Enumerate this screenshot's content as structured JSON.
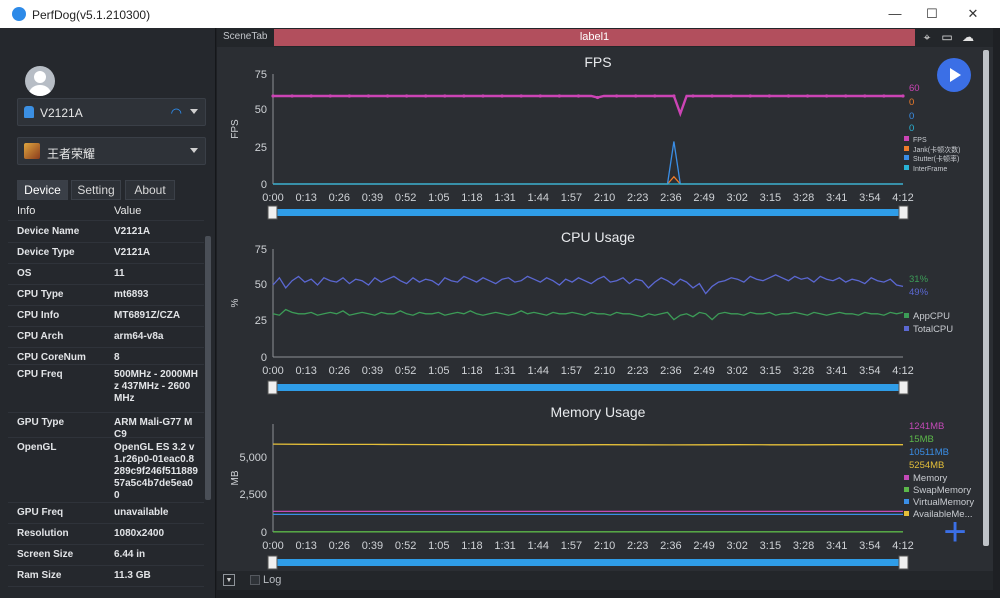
{
  "window": {
    "title": "PerfDog(v5.1.210300)"
  },
  "device": {
    "name": "V2121A"
  },
  "app": {
    "name": "王者荣耀"
  },
  "tabs": [
    "Device",
    "Setting",
    "About"
  ],
  "info": {
    "headers": [
      "Info",
      "Value"
    ],
    "rows": [
      {
        "k": "Device Name",
        "v": "V2121A"
      },
      {
        "k": "Device Type",
        "v": "V2121A"
      },
      {
        "k": "OS",
        "v": "11"
      },
      {
        "k": "CPU Type",
        "v": "mt6893"
      },
      {
        "k": "CPU Info",
        "v": "MT6891Z/CZA"
      },
      {
        "k": "CPU Arch",
        "v": "arm64-v8a"
      },
      {
        "k": "CPU CoreNum",
        "v": "8"
      },
      {
        "k": "CPU Freq",
        "v": "500MHz - 2000MHz 437MHz - 2600MHz"
      },
      {
        "k": "GPU Type",
        "v": "ARM Mali-G77 MC9"
      },
      {
        "k": "OpenGL",
        "v": "OpenGL ES 3.2 v1.r26p0-01eac0.8289c9f246f51188957a5c4b7de5ea00"
      },
      {
        "k": "GPU Freq",
        "v": "unavailable"
      },
      {
        "k": "Resolution",
        "v": "1080x2400"
      },
      {
        "k": "Screen Size",
        "v": "6.44 in"
      },
      {
        "k": "Ram Size",
        "v": "11.3 GB"
      }
    ]
  },
  "scene": {
    "tab": "SceneTab",
    "label": "label1"
  },
  "bottom": {
    "log": "Log"
  },
  "colors": {
    "fps": "#cc44b5",
    "jank": "#f07c2a",
    "stutter": "#3a8ee6",
    "interframe": "#29b3d6",
    "appcpu": "#3c9c57",
    "totalcpu": "#5b68d2",
    "memory": "#c44ab8",
    "swap": "#5cb84a",
    "virtual": "#3a8ee6",
    "available": "#e4bf39",
    "accent": "#3b6fe6"
  },
  "chart_data": [
    {
      "type": "line",
      "title": "FPS",
      "ylabel": "FPS",
      "ylim": [
        0,
        75
      ],
      "yticks": [
        "75",
        "50",
        "25",
        "0"
      ],
      "xticks": [
        "0:00",
        "0:13",
        "0:26",
        "0:39",
        "0:52",
        "1:05",
        "1:18",
        "1:31",
        "1:44",
        "1:57",
        "2:10",
        "2:23",
        "2:36",
        "2:49",
        "3:02",
        "3:15",
        "3:28",
        "3:41",
        "3:54",
        "4:12"
      ],
      "series": [
        {
          "name": "FPS",
          "current": "60",
          "values": [
            60,
            60,
            60,
            60,
            60,
            60,
            60,
            60,
            60,
            60,
            60,
            60,
            60,
            60,
            60,
            60,
            60,
            60,
            60,
            60,
            60,
            60,
            60,
            60,
            60,
            60,
            60,
            60,
            60,
            60,
            60,
            60,
            60,
            60,
            60,
            60,
            60,
            60,
            60,
            60,
            60,
            60,
            60,
            60,
            60,
            60,
            60,
            60,
            60,
            60,
            60,
            59,
            60,
            60,
            60,
            60,
            60,
            60,
            60,
            60,
            60,
            60,
            60,
            60,
            48,
            60,
            60,
            60,
            60,
            60,
            60,
            60,
            60,
            60,
            60,
            60,
            60,
            60,
            60,
            60,
            60,
            60,
            60,
            60,
            60,
            60,
            60,
            60,
            60,
            60,
            60,
            60,
            60,
            60,
            60,
            60,
            60,
            60,
            60,
            60
          ]
        },
        {
          "name": "Jank(卡顿次数)",
          "current": "0",
          "values": [
            0,
            0,
            0,
            0,
            0,
            0,
            0,
            0,
            0,
            0,
            0,
            0,
            0,
            0,
            0,
            0,
            0,
            0,
            0,
            0,
            0,
            0,
            0,
            0,
            0,
            0,
            0,
            0,
            0,
            0,
            0,
            0,
            0,
            0,
            0,
            0,
            0,
            0,
            0,
            0,
            0,
            0,
            0,
            0,
            0,
            0,
            0,
            0,
            0,
            0,
            0,
            0,
            0,
            0,
            0,
            0,
            0,
            0,
            0,
            0,
            0,
            0,
            0,
            5,
            0,
            0,
            0,
            0,
            0,
            0,
            0,
            0,
            0,
            0,
            0,
            0,
            0,
            0,
            0,
            0,
            0,
            0,
            0,
            0,
            0,
            0,
            0,
            0,
            0,
            0,
            0,
            0,
            0,
            0,
            0,
            0,
            0,
            0,
            0,
            0
          ]
        },
        {
          "name": "Stutter(卡顿率)",
          "current": "0",
          "values": [
            0,
            0,
            0,
            0,
            0,
            0,
            0,
            0,
            0,
            0,
            0,
            0,
            0,
            0,
            0,
            0,
            0,
            0,
            0,
            0,
            0,
            0,
            0,
            0,
            0,
            0,
            0,
            0,
            0,
            0,
            0,
            0,
            0,
            0,
            0,
            0,
            0,
            0,
            0,
            0,
            0,
            0,
            0,
            0,
            0,
            0,
            0,
            0,
            0,
            0,
            0,
            0,
            0,
            0,
            0,
            0,
            0,
            0,
            0,
            0,
            0,
            0,
            0,
            29,
            0,
            0,
            0,
            0,
            0,
            0,
            0,
            0,
            0,
            0,
            0,
            0,
            0,
            0,
            0,
            0,
            0,
            0,
            0,
            0,
            0,
            0,
            0,
            0,
            0,
            0,
            0,
            0,
            0,
            0,
            0,
            0,
            0,
            0,
            0,
            0
          ]
        },
        {
          "name": "InterFrame",
          "current": "0",
          "values": [
            0,
            0,
            0,
            0,
            0,
            0,
            0,
            0,
            0,
            0,
            0,
            0,
            0,
            0,
            0,
            0,
            0,
            0,
            0,
            0,
            0,
            0,
            0,
            0,
            0,
            0,
            0,
            0,
            0,
            0,
            0,
            0,
            0,
            0,
            0,
            0,
            0,
            0,
            0,
            0,
            0,
            0,
            0,
            0,
            0,
            0,
            0,
            0,
            0,
            0,
            0,
            0,
            0,
            0,
            0,
            0,
            0,
            0,
            0,
            0,
            0,
            0,
            0,
            0,
            0,
            0,
            0,
            0,
            0,
            0,
            0,
            0,
            0,
            0,
            0,
            0,
            0,
            0,
            0,
            0,
            0,
            0,
            0,
            0,
            0,
            0,
            0,
            0,
            0,
            0,
            0,
            0,
            0,
            0,
            0,
            0,
            0,
            0,
            0,
            0
          ]
        }
      ]
    },
    {
      "type": "line",
      "title": "CPU Usage",
      "ylabel": "%",
      "ylim": [
        0,
        75
      ],
      "yticks": [
        "75",
        "50",
        "25",
        "0"
      ],
      "xticks": [
        "0:00",
        "0:13",
        "0:26",
        "0:39",
        "0:52",
        "1:05",
        "1:18",
        "1:31",
        "1:44",
        "1:57",
        "2:10",
        "2:23",
        "2:36",
        "2:49",
        "3:02",
        "3:15",
        "3:28",
        "3:41",
        "3:54",
        "4:12"
      ],
      "series": [
        {
          "name": "AppCPU",
          "current": "31%",
          "values": [
            30,
            29,
            33,
            31,
            30,
            30,
            31,
            29,
            30,
            31,
            30,
            32,
            29,
            30,
            31,
            30,
            29,
            31,
            30,
            30,
            32,
            30,
            29,
            31,
            30,
            30,
            31,
            29,
            30,
            31,
            30,
            32,
            30,
            29,
            30,
            31,
            30,
            29,
            30,
            32,
            30,
            31,
            30,
            29,
            31,
            30,
            30,
            31,
            30,
            29,
            31,
            30,
            30,
            29,
            31,
            30,
            30,
            29,
            28,
            30,
            29,
            30,
            31,
            26,
            29,
            30,
            28,
            31,
            30,
            26,
            30,
            31,
            30,
            30,
            29,
            31,
            30,
            30,
            31,
            29,
            30,
            30,
            31,
            30,
            29,
            31,
            30,
            29,
            30,
            31,
            30,
            30,
            29,
            31,
            30,
            30,
            29,
            31,
            30,
            31
          ]
        },
        {
          "name": "TotalCPU",
          "current": "49%",
          "values": [
            50,
            55,
            48,
            53,
            56,
            52,
            54,
            50,
            55,
            53,
            52,
            55,
            51,
            54,
            53,
            50,
            55,
            52,
            54,
            56,
            53,
            51,
            55,
            52,
            54,
            53,
            50,
            55,
            53,
            52,
            56,
            54,
            52,
            55,
            53,
            51,
            54,
            55,
            52,
            53,
            56,
            54,
            52,
            55,
            53,
            50,
            54,
            52,
            55,
            53,
            51,
            54,
            56,
            52,
            53,
            55,
            51,
            54,
            53,
            48,
            52,
            55,
            53,
            50,
            54,
            52,
            48,
            51,
            44,
            49,
            52,
            53,
            55,
            54,
            52,
            56,
            54,
            53,
            55,
            57,
            55,
            53,
            56,
            54,
            55,
            52,
            56,
            54,
            53,
            55,
            52,
            54,
            53,
            51,
            55,
            53,
            52,
            54,
            50,
            49
          ]
        }
      ]
    },
    {
      "type": "line",
      "title": "Memory Usage",
      "ylabel": "MB",
      "ylim": [
        0,
        6500
      ],
      "yticks": [
        "5,000",
        "2,500",
        "0"
      ],
      "xticks": [
        "0:00",
        "0:13",
        "0:26",
        "0:39",
        "0:52",
        "1:05",
        "1:18",
        "1:31",
        "1:44",
        "1:57",
        "2:10",
        "2:23",
        "2:36",
        "2:49",
        "3:02",
        "3:15",
        "3:28",
        "3:41",
        "3:54",
        "4:12"
      ],
      "series": [
        {
          "name": "Memory",
          "current": "1241MB",
          "values": [
            1241,
            1241,
            1241,
            1241,
            1241,
            1241,
            1241,
            1241,
            1241,
            1241,
            1241,
            1241,
            1241,
            1241,
            1241,
            1241,
            1241,
            1241,
            1241,
            1241
          ]
        },
        {
          "name": "SwapMemory",
          "current": "15MB",
          "values": [
            15,
            15,
            15,
            15,
            15,
            15,
            15,
            15,
            15,
            15,
            15,
            15,
            15,
            15,
            15,
            15,
            15,
            15,
            15,
            15
          ]
        },
        {
          "name": "VirtualMemory",
          "current": "10511MB",
          "values": [
            1060,
            1060,
            1060,
            1060,
            1060,
            1060,
            1060,
            1060,
            1060,
            1060,
            1060,
            1060,
            1060,
            1060,
            1060,
            1060,
            1060,
            1060,
            1060,
            1060
          ]
        },
        {
          "name": "AvailableMe...",
          "current": "5254MB",
          "values": [
            5290,
            5280,
            5275,
            5270,
            5265,
            5260,
            5255,
            5255,
            5250,
            5250,
            5255,
            5250,
            5245,
            5250,
            5255,
            5250,
            5250,
            5252,
            5254,
            5254
          ]
        }
      ]
    }
  ]
}
